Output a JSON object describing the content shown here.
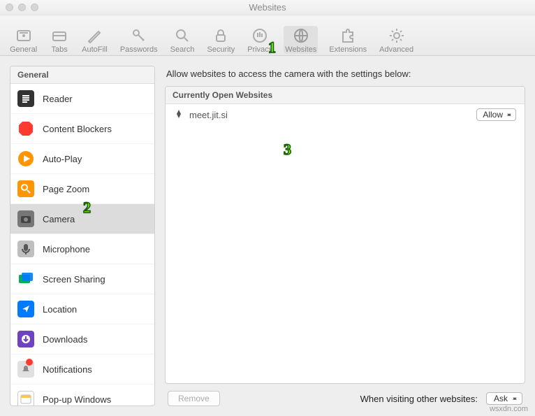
{
  "window": {
    "title": "Websites"
  },
  "toolbar": [
    {
      "key": "general",
      "label": "General"
    },
    {
      "key": "tabs",
      "label": "Tabs"
    },
    {
      "key": "autofill",
      "label": "AutoFill"
    },
    {
      "key": "passwords",
      "label": "Passwords"
    },
    {
      "key": "search",
      "label": "Search"
    },
    {
      "key": "security",
      "label": "Security"
    },
    {
      "key": "privacy",
      "label": "Privacy"
    },
    {
      "key": "websites",
      "label": "Websites",
      "selected": true
    },
    {
      "key": "extensions",
      "label": "Extensions"
    },
    {
      "key": "advanced",
      "label": "Advanced"
    }
  ],
  "sidebar": {
    "header": "General",
    "active_key": "camera",
    "items": [
      {
        "key": "reader",
        "label": "Reader"
      },
      {
        "key": "blockers",
        "label": "Content Blockers"
      },
      {
        "key": "autoplay",
        "label": "Auto-Play"
      },
      {
        "key": "pagezoom",
        "label": "Page Zoom"
      },
      {
        "key": "camera",
        "label": "Camera"
      },
      {
        "key": "microphone",
        "label": "Microphone"
      },
      {
        "key": "screenshare",
        "label": "Screen Sharing"
      },
      {
        "key": "location",
        "label": "Location"
      },
      {
        "key": "downloads",
        "label": "Downloads"
      },
      {
        "key": "notifications",
        "label": "Notifications",
        "badge": true
      },
      {
        "key": "popups",
        "label": "Pop-up Windows"
      }
    ]
  },
  "main": {
    "description": "Allow websites to access the camera with the settings below:",
    "list_header": "Currently Open Websites",
    "sites": [
      {
        "host": "meet.jit.si",
        "setting": "Allow"
      }
    ],
    "remove_label": "Remove",
    "default_label": "When visiting other websites:",
    "default_value": "Ask"
  },
  "callouts": {
    "one": "1",
    "two": "2",
    "three": "3"
  },
  "watermark": "wsxdn.com"
}
